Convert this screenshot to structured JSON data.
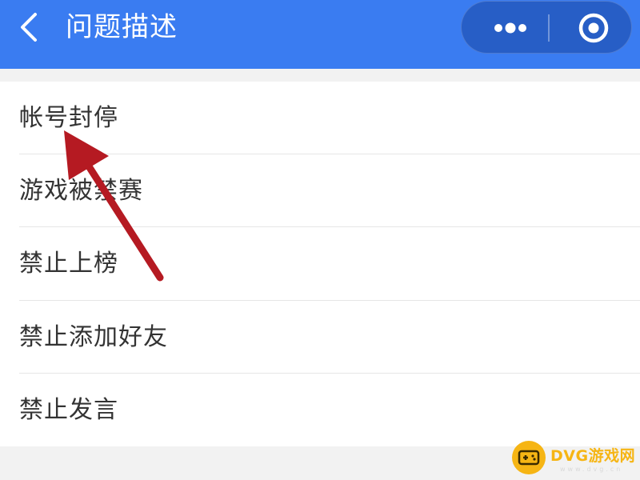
{
  "header": {
    "title": "问题描述",
    "background_color": "#3a7cf1",
    "back_icon": "chevron-left-icon",
    "more_icon": "more-dots-icon",
    "close_icon": "target-circle-icon"
  },
  "list": {
    "items": [
      {
        "label": "帐号封停"
      },
      {
        "label": "游戏被禁赛"
      },
      {
        "label": "禁止上榜"
      },
      {
        "label": "禁止添加好友"
      },
      {
        "label": "禁止发言"
      }
    ]
  },
  "annotation": {
    "type": "arrow",
    "color": "#b51a22",
    "points_to": "帐号封停"
  },
  "watermark": {
    "text": "DVG游戏网",
    "subtext": "www.dvg.cn",
    "color": "#f6b514",
    "icon": "gamepad-icon"
  }
}
